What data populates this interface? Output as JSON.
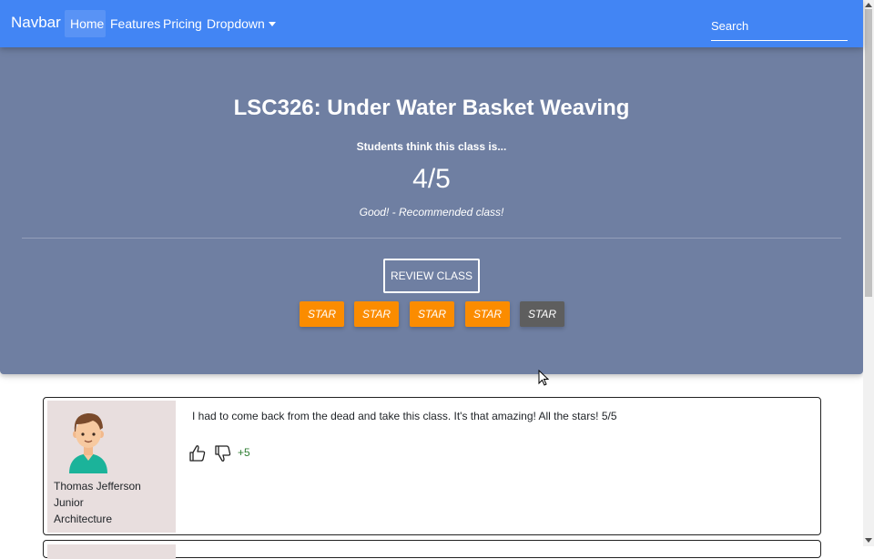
{
  "navbar": {
    "brand": "Navbar",
    "items": [
      {
        "label": "Home"
      },
      {
        "label": "Features"
      },
      {
        "label": "Pricing"
      },
      {
        "label": "Dropdown"
      }
    ],
    "search": {
      "placeholder": "Search",
      "value": ""
    }
  },
  "course": {
    "title": "LSC326: Under Water Basket Weaving",
    "subtitle": "Students think this class is...",
    "score": "4/5",
    "verdict": "Good! - Recommended class!",
    "review_button": "REVIEW CLASS",
    "stars": [
      {
        "label": "STAR",
        "active": true
      },
      {
        "label": "STAR",
        "active": true
      },
      {
        "label": "STAR",
        "active": true
      },
      {
        "label": "STAR",
        "active": true
      },
      {
        "label": "STAR",
        "active": false
      }
    ],
    "star_color_active": "#fb8c00",
    "star_color_inactive": "#5e5e5e"
  },
  "review": {
    "name": "Thomas Jefferson",
    "year": "Junior",
    "major": "Architecture",
    "text": "I had to come back from the dead and take this class. It's that amazing! All the stars! 5/5",
    "votes": "+5",
    "icons": [
      "avatar",
      "thumbs-up-icon",
      "thumbs-down-icon"
    ]
  },
  "colors": {
    "navbar": "#4285f4",
    "jumbotron": "#6f7fa2",
    "profile_bg": "#e8dede",
    "vote_positive": "#2e7d32"
  }
}
